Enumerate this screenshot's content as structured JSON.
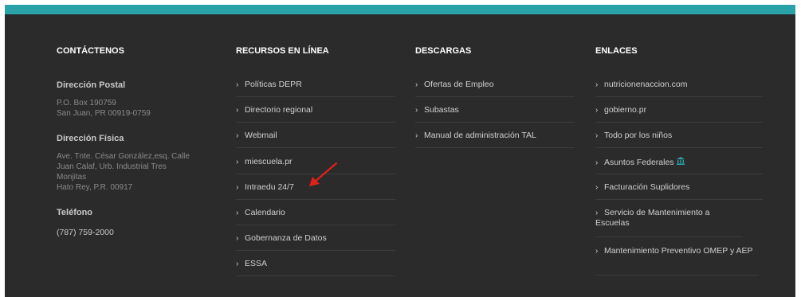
{
  "columns": {
    "contact": {
      "title": "CONTÁCTENOS",
      "postal_title": "Dirección Postal",
      "postal_lines": [
        "P.O. Box 190759",
        "San Juan, PR 00919-0759"
      ],
      "physical_title": "Dirección Física",
      "physical_lines": [
        "Ave. Tnte. César González,esq. Calle",
        "Juan Calaf, Urb. Industrial Tres",
        "Monjitas",
        "Hato Rey, P.R. 00917"
      ],
      "phone_title": "Teléfono",
      "phone": "(787) 759-2000"
    },
    "resources": {
      "title": "RECURSOS EN LÍNEA",
      "items": [
        "Políticas DEPR",
        "Directorio regional",
        "Webmail",
        "miescuela.pr",
        "Intraedu 24/7",
        "Calendario",
        "Gobernanza de Datos",
        "ESSA"
      ]
    },
    "downloads": {
      "title": "DESCARGAS",
      "items": [
        "Ofertas de Empleo",
        "Subastas",
        "Manual de administración TAL"
      ]
    },
    "links": {
      "title": "ENLACES",
      "items": [
        "nutricionenaccion.com",
        "gobierno.pr",
        "Todo por los niños",
        "Asuntos Federales",
        "Facturación Suplidores",
        "Servicio de Mantenimiento a Escuelas",
        "Mantenimiento Preventivo OMEP y AEP"
      ]
    }
  },
  "chevron": "›",
  "colors": {
    "accent": "#2aa3a8",
    "background": "#2b2b2b",
    "annotation_arrow": "#e0201b"
  },
  "icons": {
    "federal_link": "bank-icon"
  }
}
